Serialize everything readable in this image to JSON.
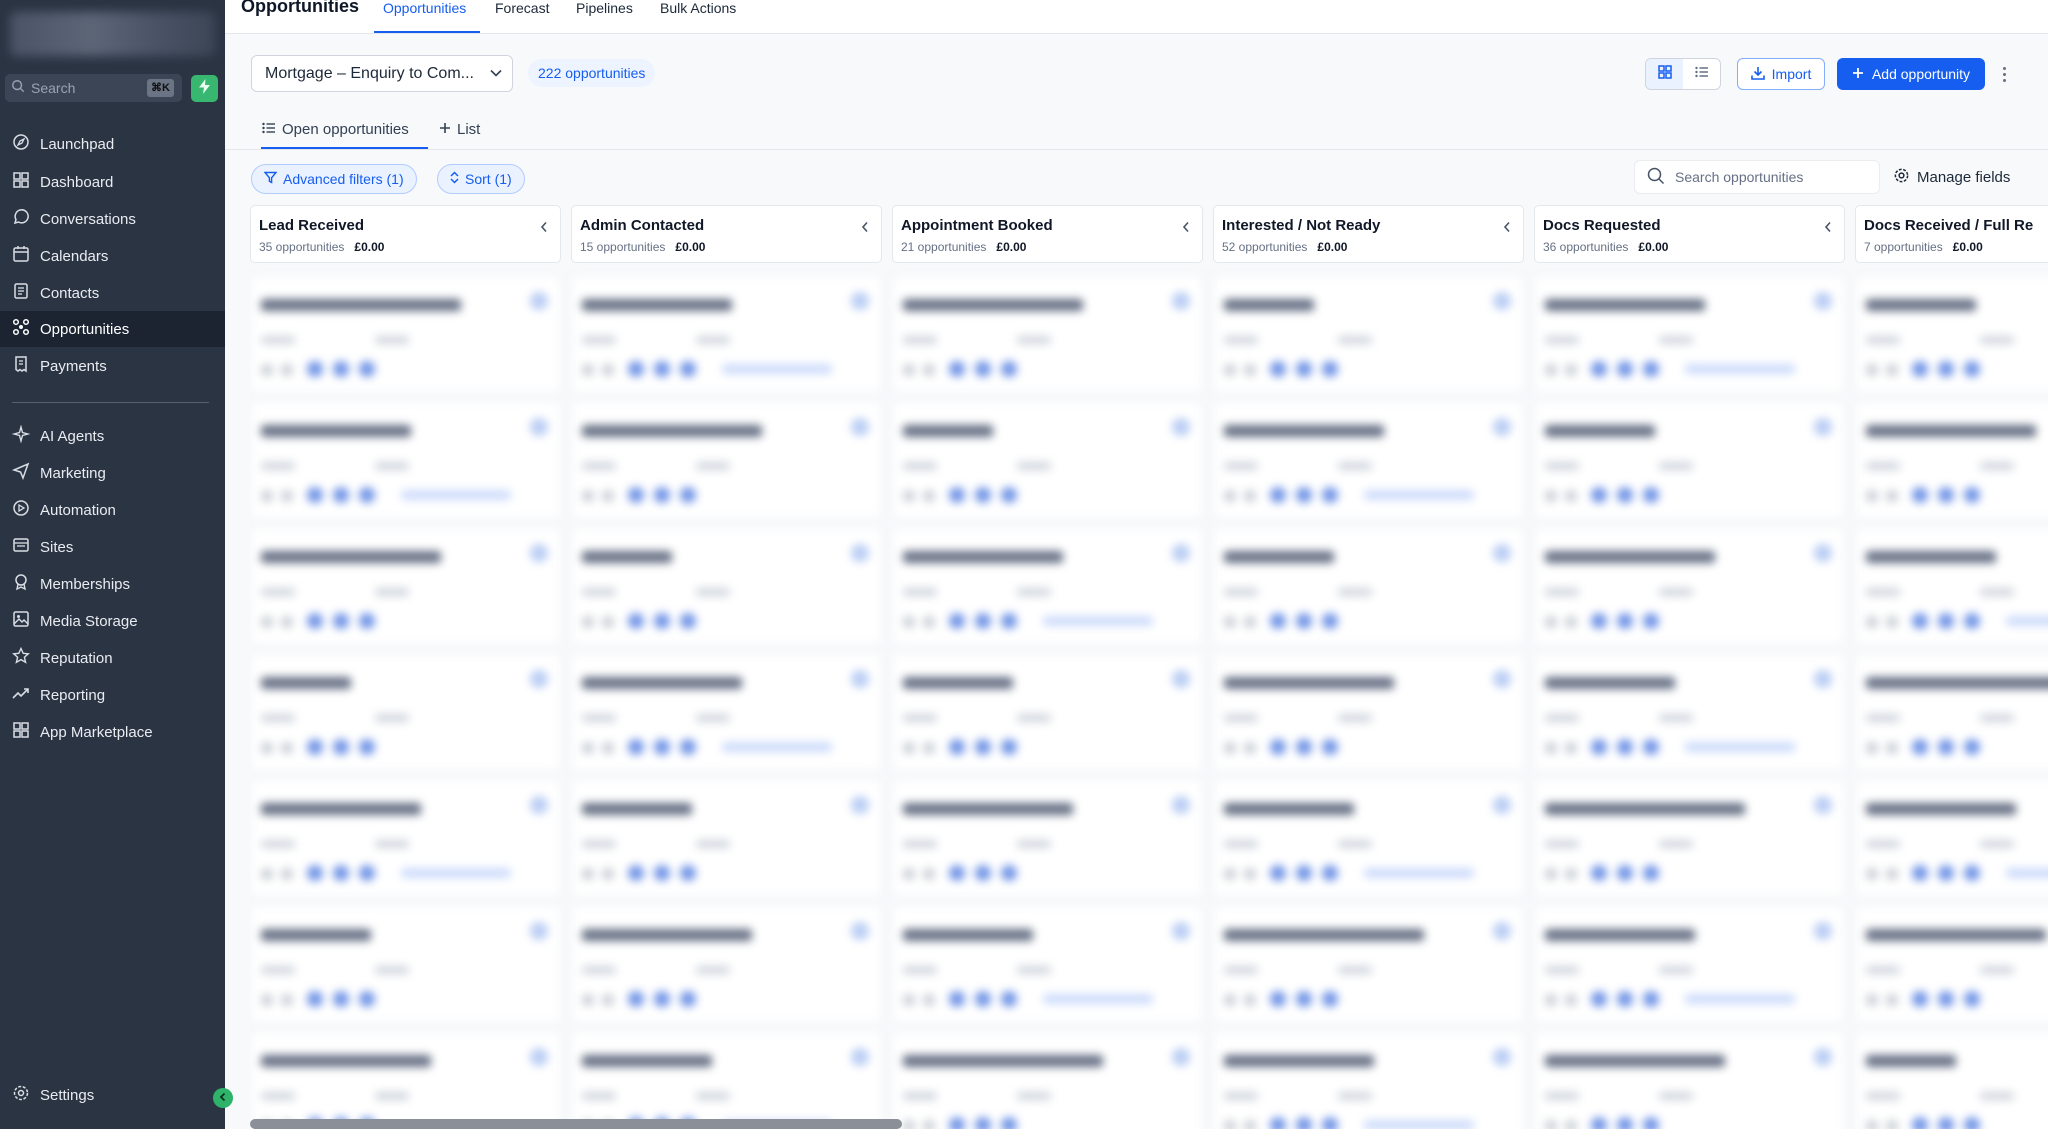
{
  "sidebar": {
    "search_placeholder": "Search",
    "search_shortcut": "⌘K",
    "items": [
      {
        "label": "Launchpad",
        "icon": "rocket-icon"
      },
      {
        "label": "Dashboard",
        "icon": "dashboard-icon"
      },
      {
        "label": "Conversations",
        "icon": "chat-bubble-icon"
      },
      {
        "label": "Calendars",
        "icon": "calendar-icon"
      },
      {
        "label": "Contacts",
        "icon": "contacts-icon"
      },
      {
        "label": "Opportunities",
        "icon": "opportunities-icon",
        "active": true
      },
      {
        "label": "Payments",
        "icon": "receipt-icon"
      },
      {
        "label": "AI Agents",
        "icon": "sparkle-icon"
      },
      {
        "label": "Marketing",
        "icon": "send-icon"
      },
      {
        "label": "Automation",
        "icon": "automation-icon"
      },
      {
        "label": "Sites",
        "icon": "sites-icon"
      },
      {
        "label": "Memberships",
        "icon": "membership-icon"
      },
      {
        "label": "Media Storage",
        "icon": "image-icon"
      },
      {
        "label": "Reputation",
        "icon": "star-icon"
      },
      {
        "label": "Reporting",
        "icon": "trend-icon"
      },
      {
        "label": "App Marketplace",
        "icon": "apps-grid-icon"
      }
    ],
    "settings_label": "Settings"
  },
  "header": {
    "title": "Opportunities",
    "tabs": [
      {
        "label": "Opportunities",
        "active": true
      },
      {
        "label": "Forecast"
      },
      {
        "label": "Pipelines"
      },
      {
        "label": "Bulk Actions"
      }
    ]
  },
  "toolbar": {
    "pipeline": "Mortgage – Enquiry to Com...",
    "count": "222 opportunities",
    "import_label": "Import",
    "add_label": "Add opportunity"
  },
  "subtabs": {
    "open_label": "Open opportunities",
    "list_label": "List"
  },
  "filters": {
    "advanced": "Advanced filters (1)",
    "sort": "Sort (1)",
    "search_placeholder": "Search opportunities",
    "manage_fields": "Manage fields"
  },
  "columns": [
    {
      "title": "Lead Received",
      "count": "35 opportunities",
      "value": "£0.00"
    },
    {
      "title": "Admin Contacted",
      "count": "15 opportunities",
      "value": "£0.00"
    },
    {
      "title": "Appointment Booked",
      "count": "21 opportunities",
      "value": "£0.00"
    },
    {
      "title": "Interested / Not Ready",
      "count": "52 opportunities",
      "value": "£0.00"
    },
    {
      "title": "Docs Requested",
      "count": "36 opportunities",
      "value": "£0.00"
    },
    {
      "title": "Docs Received / Full Re",
      "count": "7 opportunities",
      "value": "£0.00"
    }
  ],
  "colors": {
    "sidebar_bg": "#2b3443",
    "accent": "#155eef",
    "active_nav": "#1c2331"
  }
}
